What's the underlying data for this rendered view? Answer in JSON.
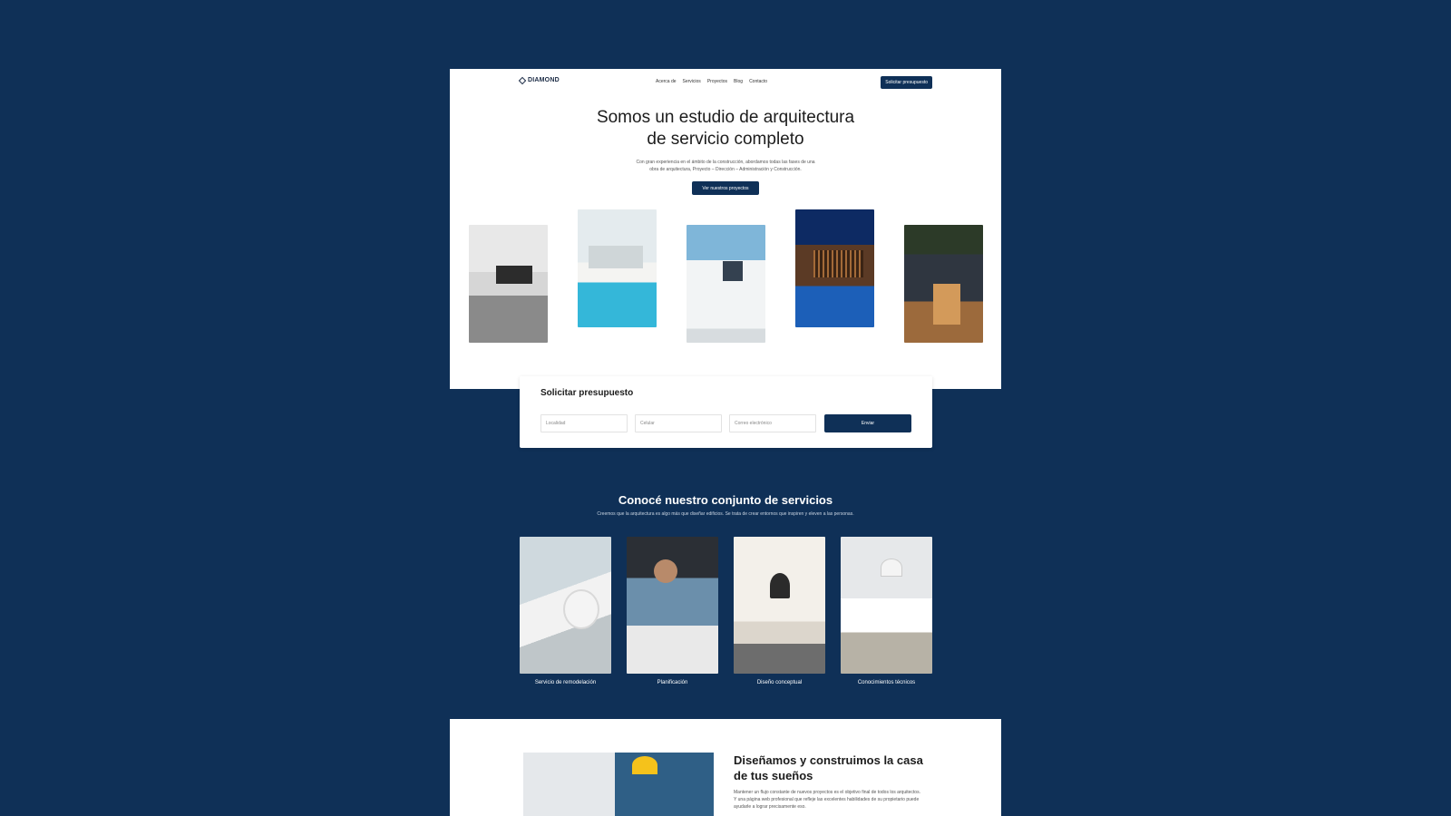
{
  "nav": {
    "logo": "DIAMOND",
    "items": [
      "Acerca de",
      "Servicios",
      "Proyectos",
      "Blog",
      "Contacto"
    ],
    "cta": "Solicitar presupuesto"
  },
  "hero": {
    "title_line1": "Somos un estudio de arquitectura",
    "title_line2": "de servicio completo",
    "subtitle": "Con gran experiencia en el ámbito de la construcción, abordamos todas las fases de una obra de arquitectura, Proyecto – Dirección – Administración y Construcción.",
    "button": "Ver nuestros proyectos"
  },
  "quote": {
    "title": "Solicitar presupuesto",
    "fields": [
      "Localidad",
      "Celular",
      "Correo electrónico"
    ],
    "submit": "Enviar"
  },
  "services": {
    "title": "Conocé nuestro conjunto de servicios",
    "subtitle": "Creemos que la arquitectura es algo más que diseñar edificios. Se trata de crear entornos que inspiren y eleven a las personas.",
    "cards": [
      {
        "label": "Servicio de remodelación"
      },
      {
        "label": "Planificación"
      },
      {
        "label": "Diseño conceptual"
      },
      {
        "label": "Conocimientos técnicos"
      }
    ]
  },
  "feature": {
    "title": "Diseñamos y construimos la casa de tus sueños",
    "text": "Mantener un flujo constante de nuevos proyectos es el objetivo final de todos los arquitectos. Y una página web profesional que refleje las excelentes habilidades de su propietario puede ayudarle a lograr precisamente eso."
  }
}
